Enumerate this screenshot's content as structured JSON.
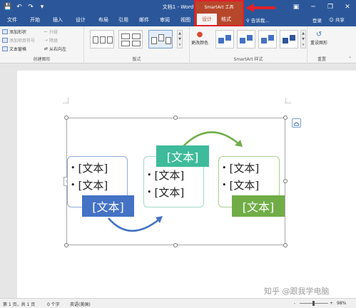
{
  "titlebar": {
    "title": "文档1 - Word",
    "contextual_group": "SmartArt 工具",
    "minimize": "─",
    "restore": "❐",
    "close": "✕",
    "ribbon_display": "▣"
  },
  "tabs": {
    "file": "文件",
    "home": "开始",
    "insert": "插入",
    "design": "设计",
    "layout": "布局",
    "references": "引用",
    "mailings": "邮件",
    "review": "审阅",
    "view": "视图",
    "smartart_design": "设计",
    "smartart_format": "格式",
    "tell_me": "告诉我...",
    "sign_in": "登录",
    "share": "共享"
  },
  "ribbon": {
    "create_graphic": {
      "add_shape": "添加形状",
      "add_bullet": "添加项目符号",
      "text_pane": "文本窗格",
      "promote": "升级",
      "demote": "降级",
      "right_to_left": "从右向左",
      "label": "创建图形"
    },
    "layouts": {
      "label": "版式"
    },
    "styles": {
      "change_colors": "更改颜色",
      "label": "SmartArt 样式"
    },
    "reset": {
      "reset_graphic": "重设图形",
      "label": "重置"
    }
  },
  "smartart": {
    "panel_left": [
      "[文本]",
      "[文本]"
    ],
    "panel_middle": [
      "[文本]",
      "[文本]"
    ],
    "panel_right": [
      "[文本]",
      "[文本]"
    ],
    "label_left": "[文本]",
    "label_middle": "[文本]",
    "label_right": "[文本]",
    "colors": {
      "blue": "#4472c4",
      "teal": "#3ebb9b",
      "green": "#70ad47"
    }
  },
  "statusbar": {
    "page": "第 1 页，共 1 页",
    "words": "0 个字",
    "language": "英语(美国)",
    "zoom": "98%",
    "zoom_minus": "-",
    "zoom_plus": "+"
  },
  "watermark": "知乎 @跟我学电脑"
}
